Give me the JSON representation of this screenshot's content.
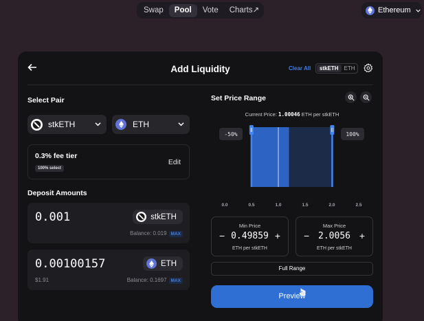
{
  "nav": {
    "items": [
      "Swap",
      "Pool",
      "Vote",
      "Charts↗"
    ],
    "active": "Pool"
  },
  "network": {
    "label": "Ethereum"
  },
  "card": {
    "title": "Add Liquidity",
    "clear_all": "Clear All",
    "toggle": {
      "options": [
        "stkETH",
        "ETH"
      ],
      "selected": "stkETH"
    }
  },
  "select_pair": {
    "heading": "Select Pair",
    "token_a": "stkETH",
    "token_b": "ETH"
  },
  "fee": {
    "tier": "0.3% fee tier",
    "badge": "100% select",
    "edit": "Edit"
  },
  "deposit": {
    "heading": "Deposit Amounts",
    "a": {
      "amount": "0.001",
      "token": "stkETH",
      "balance": "Balance: 0.019",
      "max": "MAX"
    },
    "b": {
      "amount": "0.00100157",
      "token": "ETH",
      "usd": "$1.91",
      "balance": "Balance: 0.1697",
      "max": "MAX"
    }
  },
  "price_range": {
    "heading": "Set Price Range",
    "current_label": "Current Price:",
    "current_value": "1.00046",
    "current_unit": "ETH per stkETH",
    "min_pct": "-50%",
    "max_pct": "100%",
    "min": {
      "label": "Min Price",
      "value": "0.49859",
      "unit": "ETH per stkETH"
    },
    "max": {
      "label": "Max Price",
      "value": "2.0056",
      "unit": "ETH per stkETH"
    },
    "full_range": "Full Range",
    "preview": "Preview"
  },
  "chart_data": {
    "type": "bar",
    "x_ticks": [
      "0.0",
      "0.5",
      "1.0",
      "1.5",
      "2.0",
      "2.5"
    ],
    "xlim": [
      0,
      2.5
    ],
    "bins": [
      {
        "from": 0.5,
        "to": 1.2,
        "level": 1.0
      },
      {
        "from": 1.2,
        "to": 2.0,
        "level": 1.0
      }
    ],
    "current_price": 1.00046,
    "range_min": 0.49859,
    "range_max": 2.0056
  },
  "colors": {
    "accent": "#2f6fd4",
    "card": "#131316",
    "background": "#2d2129"
  }
}
